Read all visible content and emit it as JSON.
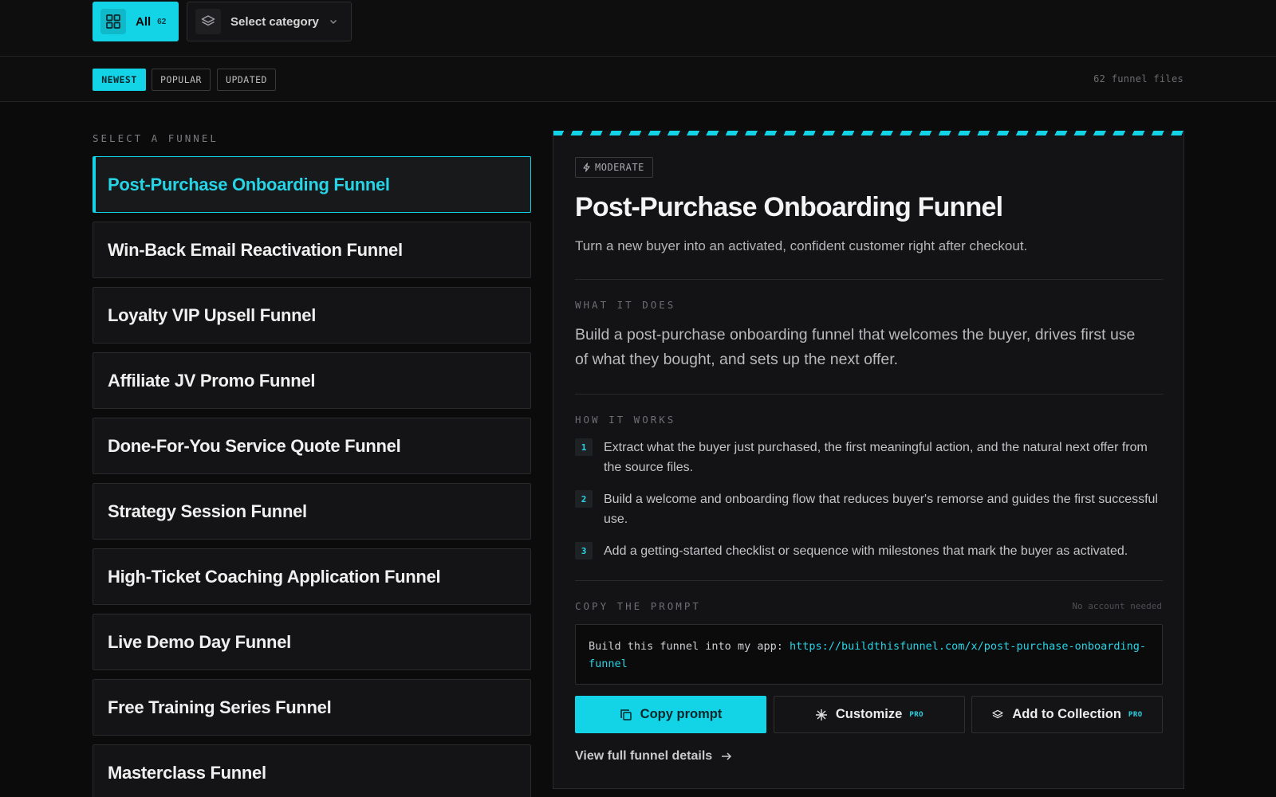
{
  "filters": {
    "all_label": "All",
    "all_count": "62",
    "category_label": "Select category"
  },
  "sort": {
    "options": [
      "NEWEST",
      "POPULAR",
      "UPDATED"
    ],
    "active": "NEWEST",
    "file_count": "62 funnel files"
  },
  "list": {
    "section_label": "SELECT A FUNNEL",
    "items": [
      "Post-Purchase Onboarding Funnel",
      "Win-Back Email Reactivation Funnel",
      "Loyalty VIP Upsell Funnel",
      "Affiliate JV Promo Funnel",
      "Done-For-You Service Quote Funnel",
      "Strategy Session Funnel",
      "High-Ticket Coaching Application Funnel",
      "Live Demo Day Funnel",
      "Free Training Series Funnel",
      "Masterclass Funnel"
    ],
    "selected_index": 0
  },
  "detail": {
    "difficulty": "MODERATE",
    "title": "Post-Purchase Onboarding Funnel",
    "subtitle": "Turn a new buyer into an activated, confident customer right after checkout.",
    "what_label": "WHAT IT DOES",
    "what_text": "Build a post-purchase onboarding funnel that welcomes the buyer, drives first use of what they bought, and sets up the next offer.",
    "how_label": "HOW IT WORKS",
    "steps": [
      {
        "num": "1",
        "text": "Extract what the buyer just purchased, the first meaningful action, and the natural next offer from the source files."
      },
      {
        "num": "2",
        "text": "Build a welcome and onboarding flow that reduces buyer's remorse and guides the first successful use."
      },
      {
        "num": "3",
        "text": "Add a getting-started checklist or sequence with milestones that mark the buyer as activated."
      }
    ],
    "copy_label": "COPY THE PROMPT",
    "no_account": "No account needed",
    "prompt_prefix": "Build this funnel into my app: ",
    "prompt_url": "https://buildthisfunnel.com/x/post-purchase-onboarding-funnel",
    "copy_button": "Copy prompt",
    "customize_button": "Customize",
    "collection_button": "Add to Collection",
    "pro_tag": "PRO",
    "view_link": "View full funnel details"
  },
  "colors": {
    "accent": "#13d3e6",
    "background": "#0b0b0c",
    "panel": "#131315"
  }
}
